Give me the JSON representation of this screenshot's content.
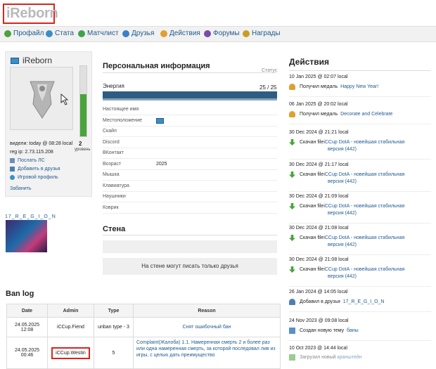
{
  "title": "iReborn",
  "nav": [
    {
      "label": "Профайл",
      "color": "#4aa33c"
    },
    {
      "label": "Стата",
      "color": "#3a8fc7"
    },
    {
      "label": "Матчлист",
      "color": "#3fa34d"
    },
    {
      "label": "Друзья",
      "color": "#3a7fc7"
    },
    {
      "label": "Действия",
      "color": "#e0a030"
    },
    {
      "label": "Форумы",
      "color": "#7a4aa8"
    },
    {
      "label": "Награды",
      "color": "#c8a020"
    }
  ],
  "profile": {
    "username": "iReborn",
    "seen": "видели: today @ 08:28 local",
    "reg_ip": "reg ip: 2.73.115.208",
    "level": "2",
    "level_label": "уровень",
    "level_fill": 0.6,
    "links": [
      "Послать ЛС",
      "Добавить в друзья",
      "Игровой профиль"
    ],
    "ban": "Забанить"
  },
  "friend": {
    "name": "17_R_E_G_I_O_N"
  },
  "personal": {
    "heading": "Персональная информация",
    "status_label": "Статус",
    "energy_label": "Энергия",
    "energy_value": "25 / 25",
    "rows": [
      {
        "key": "Настоящее имя",
        "value": ""
      },
      {
        "key": "Местоположение",
        "value": ""
      },
      {
        "key": "Скайп",
        "value": ""
      },
      {
        "key": "Discord",
        "value": ""
      },
      {
        "key": "ВКонтакт",
        "value": ""
      },
      {
        "key": "Возраст",
        "value": "2025"
      },
      {
        "key": "Мышка",
        "value": ""
      },
      {
        "key": "Клавиатура",
        "value": ""
      },
      {
        "key": "Наушники",
        "value": ""
      },
      {
        "key": "Коврик",
        "value": ""
      }
    ]
  },
  "wall": {
    "heading": "Стена",
    "message": "На стене могут писать только друзья"
  },
  "actions": {
    "heading": "Действия",
    "items": [
      {
        "date": "10 Jan 2025 @ 02:07 local",
        "type": "medal",
        "text": "Получил медаль",
        "link": "Happy New Year!",
        "extra": ""
      },
      {
        "date": "06 Jan 2025 @ 20:02 local",
        "type": "medal",
        "text": "Получил медаль",
        "link": "Decorate and Celebrate",
        "extra": ""
      },
      {
        "date": "30 Dec 2024 @ 21:21 local",
        "type": "download",
        "text": "Скачан file",
        "link": "iCCup DotA - новейшая стабильная",
        "extra": "версия (442)"
      },
      {
        "date": "30 Dec 2024 @ 21:17 local",
        "type": "download",
        "text": "Скачан file",
        "link": "iCCup DotA - новейшая стабильная",
        "extra": "версия (442)"
      },
      {
        "date": "30 Dec 2024 @ 21:09 local",
        "type": "download",
        "text": "Скачан file",
        "link": "iCCup DotA - новейшая стабильная",
        "extra": "версия (442)"
      },
      {
        "date": "30 Dec 2024 @ 21:08 local",
        "type": "download",
        "text": "Скачан file",
        "link": "iCCup DotA - новейшая стабильная",
        "extra": "версия (442)"
      },
      {
        "date": "30 Dec 2024 @ 21:08 local",
        "type": "download",
        "text": "Скачан file",
        "link": "iCCup DotA - новейшая стабильная",
        "extra": "версия (442)"
      },
      {
        "date": "26 Jan 2024 @ 14:05 local",
        "type": "friend",
        "text": "Добавил в друзья",
        "link": "17_R_E_G_I_O_N",
        "extra": ""
      },
      {
        "date": "24 Nov 2023 @ 09:08 local",
        "type": "topic",
        "text": "Создан новую тему",
        "link": "баны",
        "extra": ""
      },
      {
        "date": "10 Oct 2023 @ 14:44 local",
        "type": "download",
        "text": "Загрузил новый",
        "link": "кранштейн",
        "extra": ""
      }
    ]
  },
  "banlog": {
    "heading": "Ban log",
    "columns": [
      "Date",
      "Admin",
      "Type",
      "Reason"
    ],
    "rows": [
      {
        "date": "24.05.2025 12:08",
        "admin": "iCCup.Fiend",
        "type": "unban type - 3",
        "reason": "Снят ошибочный бан"
      },
      {
        "date": "24.05.2025 00:46",
        "admin": "iCCup.Westin",
        "type": "5",
        "reason": "Complaint(Жалоба) 1.1. Намеренная смерть 2 и более раз или одна намеренная смерть, за которой последовал лив из игры, с целью дать преимущество"
      }
    ]
  }
}
